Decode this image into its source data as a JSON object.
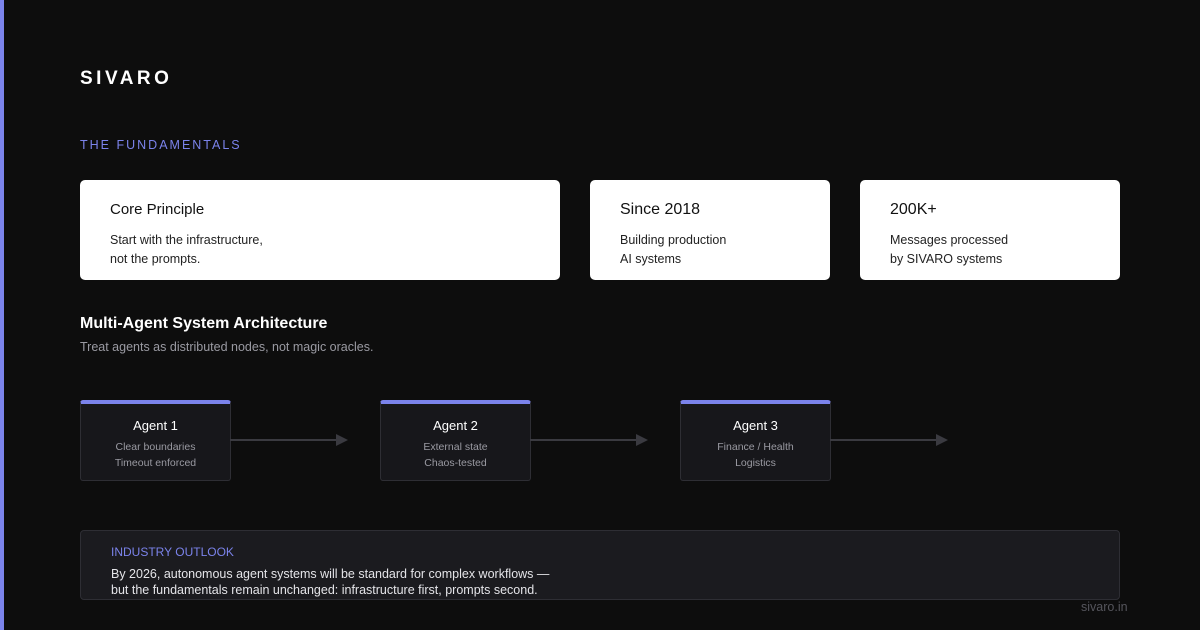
{
  "brand": "SIVARO",
  "section_label": "THE FUNDAMENTALS",
  "cards": [
    {
      "title": "Core Principle",
      "lines": [
        "Start with the infrastructure,",
        "not the prompts."
      ]
    },
    {
      "title": "Since 2018",
      "lines": [
        "Building production",
        "AI systems"
      ]
    },
    {
      "title": "200K+",
      "lines": [
        "Messages processed",
        "by SIVARO systems"
      ]
    }
  ],
  "architecture": {
    "title": "Multi-Agent System Architecture",
    "subtitle": "Treat agents as distributed nodes, not magic oracles.",
    "agents": [
      {
        "name": "Agent 1",
        "lines": [
          "Clear boundaries",
          "Timeout enforced"
        ]
      },
      {
        "name": "Agent 2",
        "lines": [
          "External state",
          "Chaos-tested"
        ]
      },
      {
        "name": "Agent 3",
        "lines": [
          "Finance / Health",
          "Logistics"
        ]
      }
    ]
  },
  "outlook": {
    "label": "INDUSTRY OUTLOOK",
    "lines": [
      "By 2026, autonomous agent systems will be standard for complex workflows —",
      "but the fundamentals remain unchanged: infrastructure first, prompts second."
    ]
  },
  "footer_url": "sivaro.in",
  "colors": {
    "accent": "#7b83eb",
    "background": "#0d0d0d",
    "card": "#ffffff",
    "connector": "#3a3a40"
  }
}
